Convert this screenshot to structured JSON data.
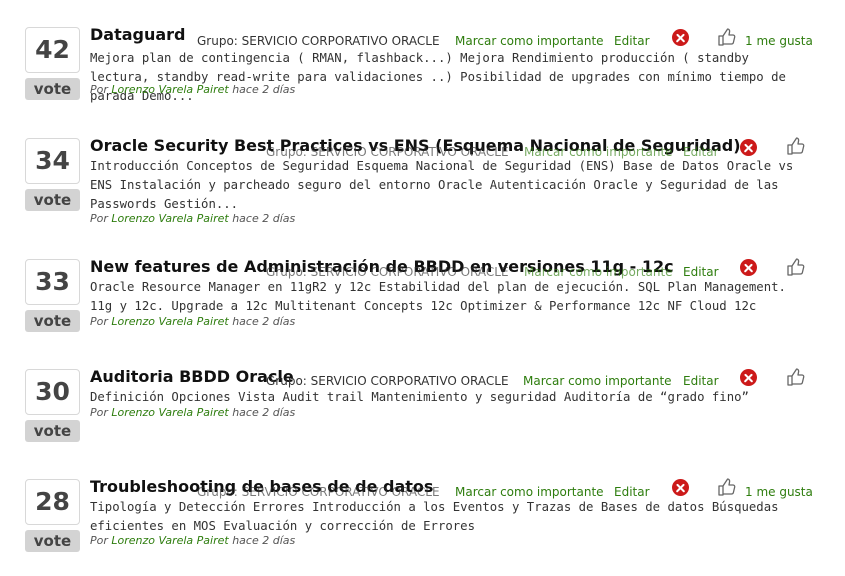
{
  "common": {
    "vote_label": "vote",
    "by_label": "Por",
    "author": "Lorenzo Varela Pairet",
    "time": "hace 2 días",
    "group_label": "Grupo:",
    "group_name": "SERVICIO CORPORATIVO ORACLE",
    "mark_label": "Marcar como importante",
    "edit_label": "Editar",
    "likes_text": "1 me gusta"
  },
  "ideas": [
    {
      "votes": "42",
      "title": "Dataguard",
      "description": "Mejora plan de contingencia ( RMAN, flashback...) Mejora Rendimiento producción ( standby lectura, standby read-write para validaciones ..) Posibilidad de upgrades con mínimo tiempo de parada Demo..."
    },
    {
      "votes": "34",
      "title": "Oracle Security Best Practices vs ENS (Esquema Nacional de Seguridad)",
      "description": "Introducción Conceptos de Seguridad Esquema Nacional de Seguridad (ENS) Base de Datos Oracle vs ENS Instalación y parcheado seguro del entorno Oracle Autenticación Oracle y Seguridad de las Passwords Gestión..."
    },
    {
      "votes": "33",
      "title": "New features de Administración de BBDD en versiones 11g - 12c",
      "description": "Oracle Resource Manager en 11gR2 y 12c Estabilidad del plan de ejecución. SQL Plan Management. 11g y 12c. Upgrade a 12c Multitenant Concepts 12c Optimizer & Performance 12c NF Cloud 12c"
    },
    {
      "votes": "30",
      "title": "Auditoria BBDD Oracle",
      "description": "Definición Opciones Vista Audit trail Mantenimiento y seguridad Auditoría de “grado fino”"
    },
    {
      "votes": "28",
      "title": "Troubleshooting de bases de de datos",
      "description": "Tipología y Detección Errores Introducción a los Eventos y Trazas de Bases de datos Búsquedas eficientes en MOS Evaluación y corrección de Errores"
    }
  ]
}
